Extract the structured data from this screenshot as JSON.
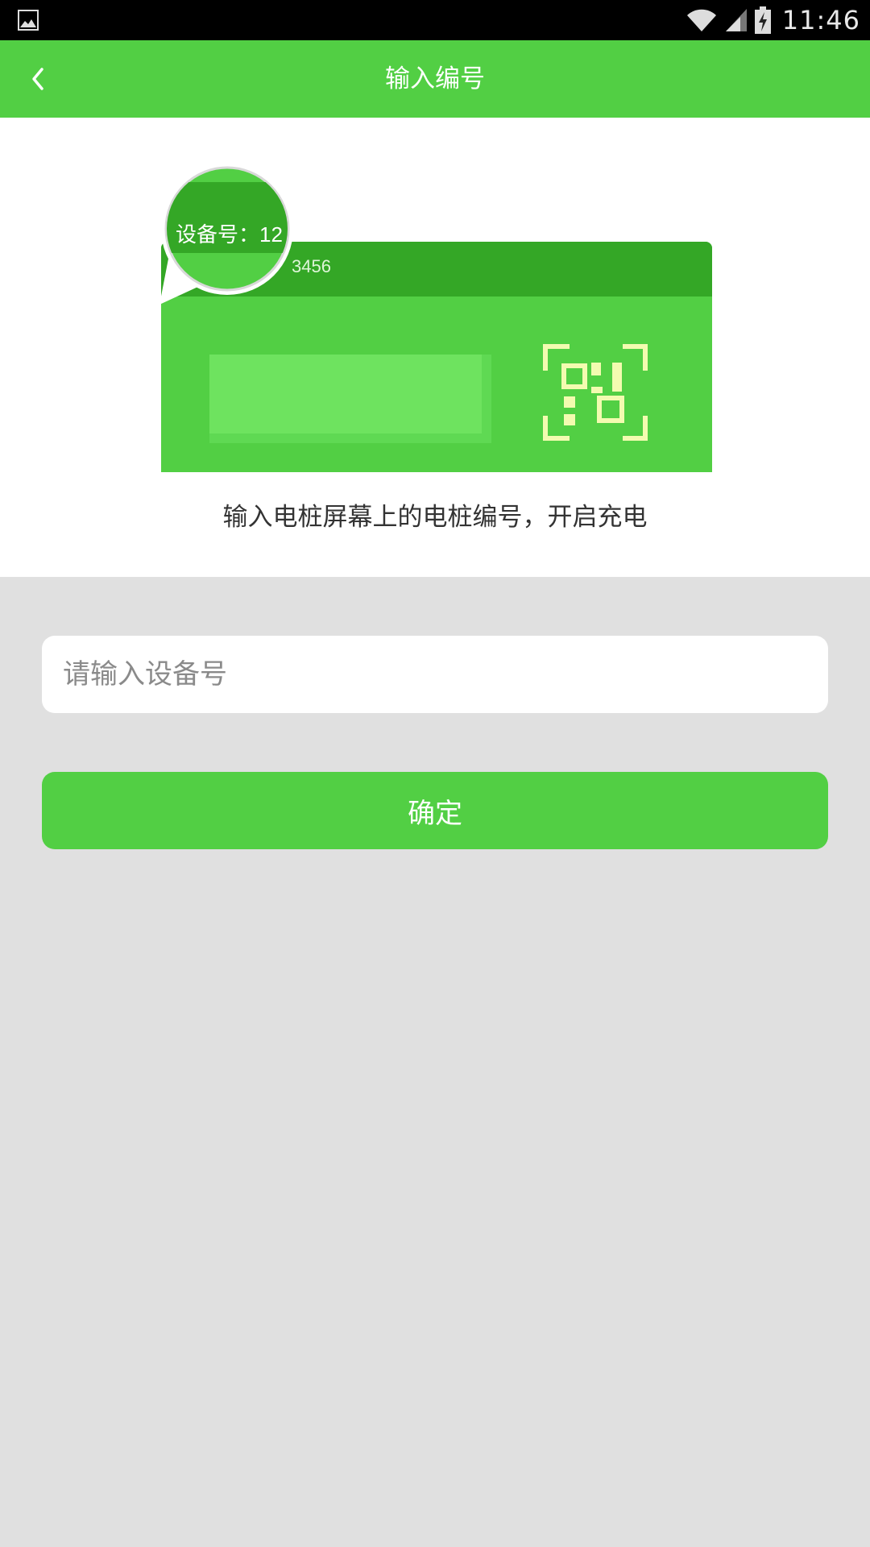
{
  "status_bar": {
    "time": "11:46",
    "icons": [
      "gallery-icon",
      "wifi-icon",
      "signal-icon",
      "battery-charging-icon"
    ]
  },
  "app_bar": {
    "title": "输入编号",
    "back_icon": "chevron-left-icon",
    "color": "#52cf44"
  },
  "hero": {
    "bubble_label": "设备号：12",
    "device_number_tail": "3456",
    "caption": "输入电桩屏幕上的电桩编号，开启充电"
  },
  "form": {
    "input_placeholder": "请输入设备号",
    "input_value": "",
    "confirm_label": "确定"
  },
  "colors": {
    "primary": "#52cf44",
    "primary_dark": "#33a828",
    "background": "#e0e0e0"
  }
}
